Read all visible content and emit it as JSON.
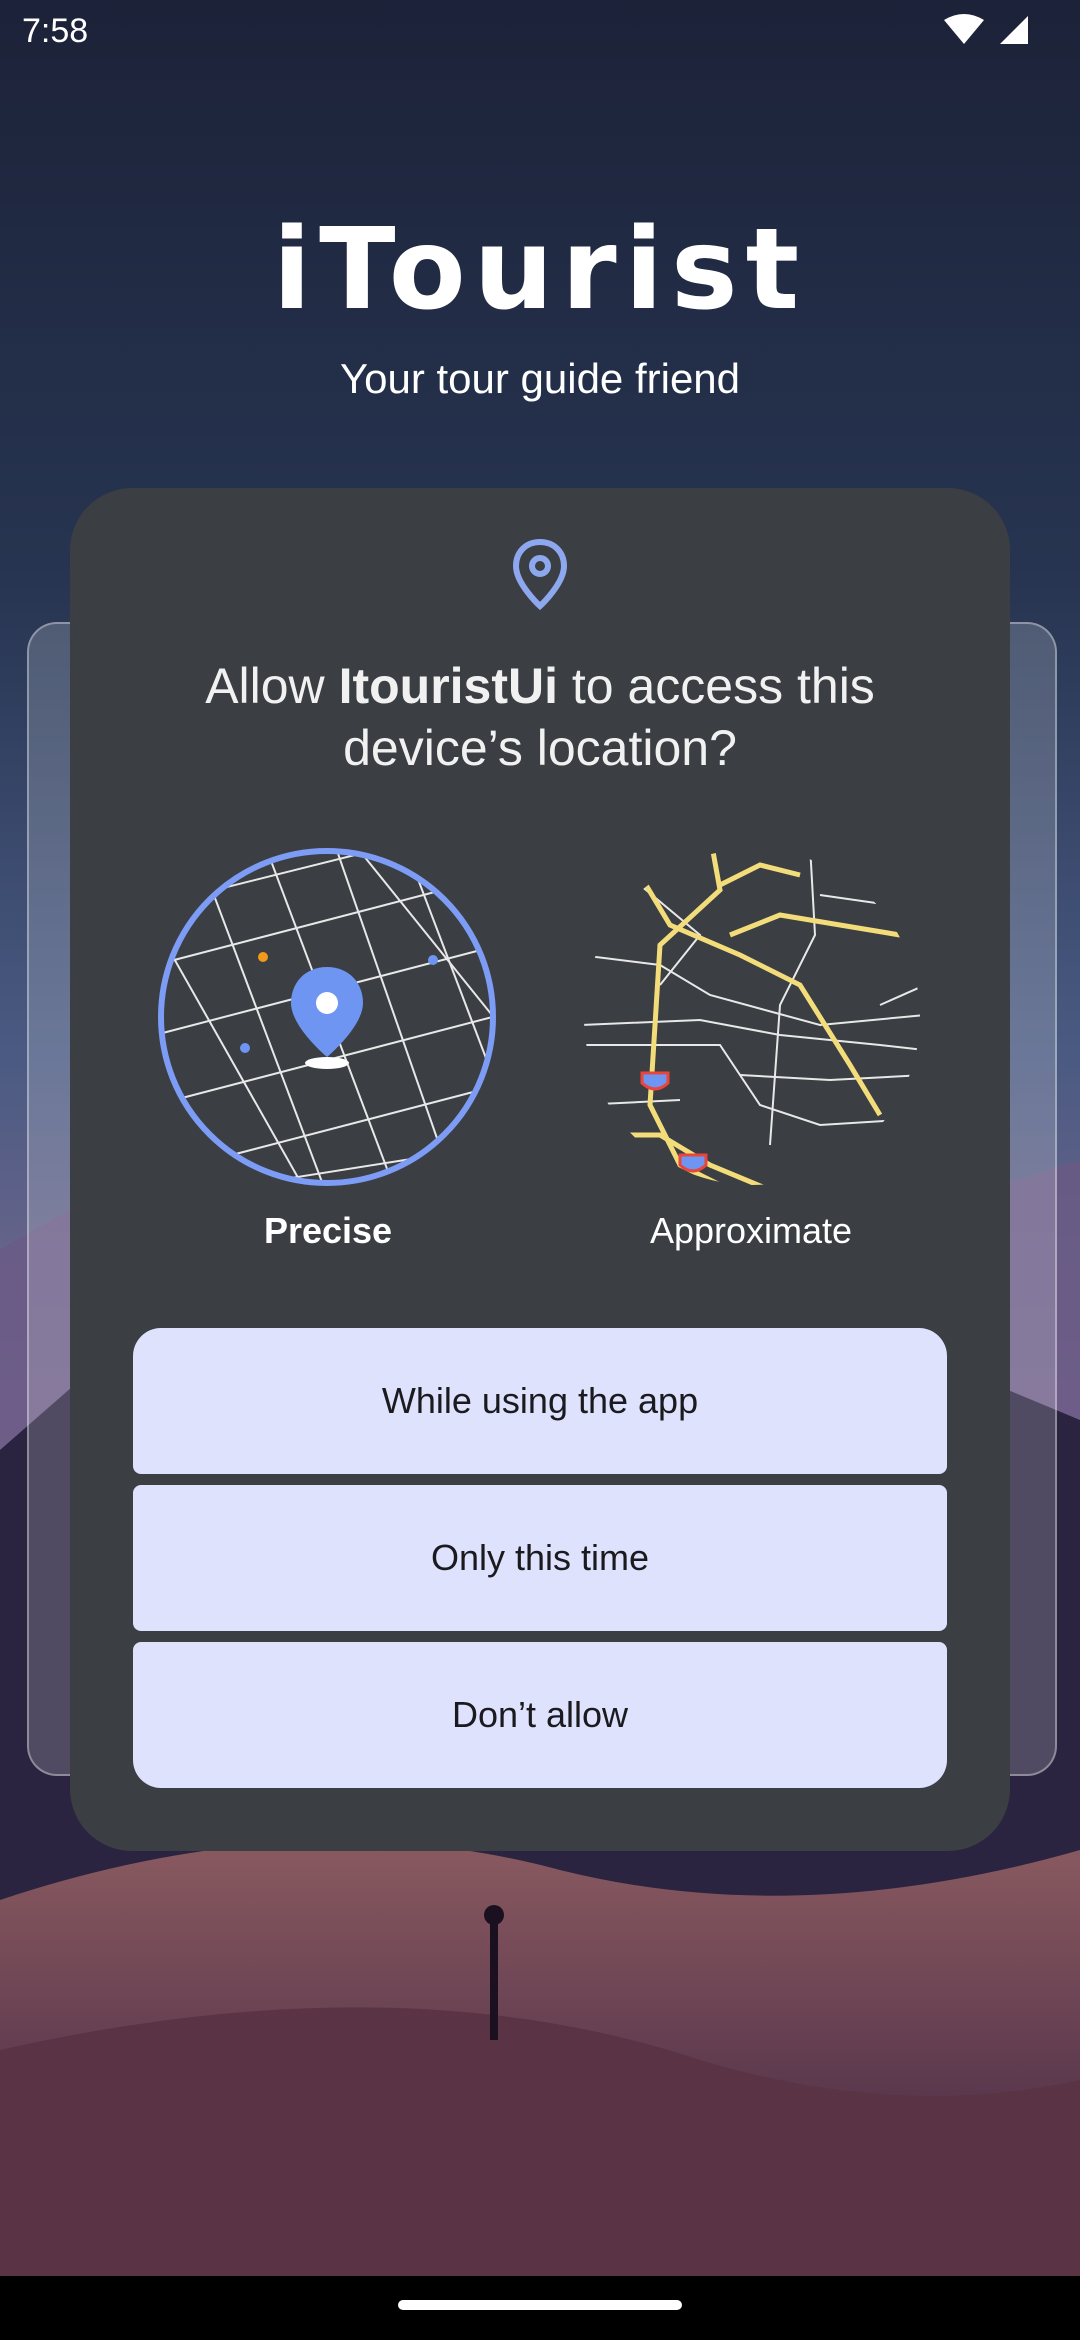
{
  "status_bar": {
    "time": "7:58"
  },
  "header": {
    "title": "iTourist",
    "subtitle": "Your tour guide friend"
  },
  "dialog": {
    "title_prefix": "Allow ",
    "app_name": "ItouristUi",
    "title_suffix": " to access this device’s location?",
    "options": {
      "precise_label": "Precise",
      "approximate_label": "Approximate",
      "selected": "Precise"
    },
    "buttons": {
      "while_using": "While using the app",
      "only_this_time": "Only this time",
      "dont_allow": "Don’t allow"
    }
  },
  "colors": {
    "accent": "#7c9cf5",
    "dialog_bg": "#3b3e42",
    "button_bg": "#dee2fd"
  }
}
